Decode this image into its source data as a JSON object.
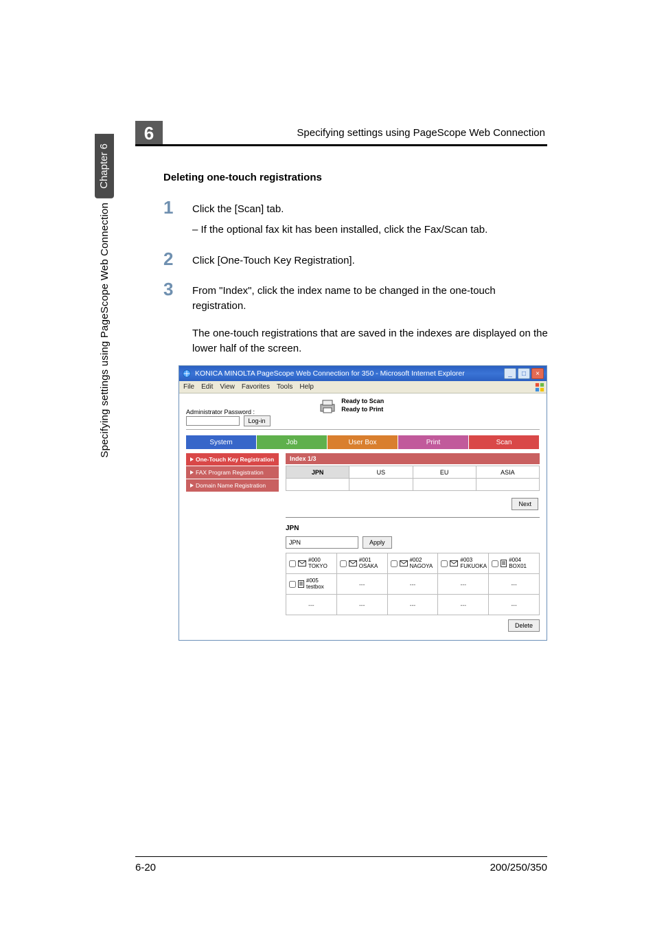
{
  "side": {
    "chapter_badge": "Chapter 6",
    "text": "Specifying settings using PageScope Web Connection"
  },
  "chapter_num": "6",
  "header_right": "Specifying settings using PageScope Web Connection",
  "subheading": "Deleting one-touch registrations",
  "steps": {
    "s1": {
      "num": "1",
      "text": "Click the [Scan] tab.",
      "sub": "If the optional fax kit has been installed, click the Fax/Scan tab."
    },
    "s2": {
      "num": "2",
      "text": "Click [One-Touch Key Registration]."
    },
    "s3": {
      "num": "3",
      "text": "From \"Index\", click the index name to be changed in the one-touch registration."
    }
  },
  "after_step3": "The one-touch registrations that are saved in the indexes are displayed on the lower half of the screen.",
  "window": {
    "title": "KONICA MINOLTA PageScope Web Connection for 350 - Microsoft Internet Explorer",
    "menus": [
      "File",
      "Edit",
      "View",
      "Favorites",
      "Tools",
      "Help"
    ],
    "status": {
      "line1": "Ready to Scan",
      "line2": "Ready to Print"
    },
    "admin_label": "Administrator Password :",
    "login": "Log-in",
    "tabs": {
      "system": "System",
      "job": "Job",
      "userbox": "User Box",
      "print": "Print",
      "scan": "Scan"
    },
    "nav": {
      "onetouch": "One-Touch Key Registration",
      "fax": "FAX Program Registration",
      "domain": "Domain Name Registration"
    },
    "index_label": "Index 1/3",
    "index_tabs": [
      "JPN",
      "US",
      "EU",
      "ASIA"
    ],
    "next": "Next",
    "group_label": "JPN",
    "group_input": "JPN",
    "apply": "Apply",
    "entries": [
      {
        "num": "#000",
        "name": "TOKYO",
        "type": "mail"
      },
      {
        "num": "#001",
        "name": "OSAKA",
        "type": "mail"
      },
      {
        "num": "#002",
        "name": "NAGOYA",
        "type": "mail"
      },
      {
        "num": "#003",
        "name": "FUKUOKA",
        "type": "mail"
      },
      {
        "num": "#004",
        "name": "BOX01",
        "type": "doc"
      },
      {
        "num": "#005",
        "name": "testbox",
        "type": "doc"
      }
    ],
    "delete": "Delete"
  },
  "footer": {
    "left": "6-20",
    "right": "200/250/350"
  }
}
